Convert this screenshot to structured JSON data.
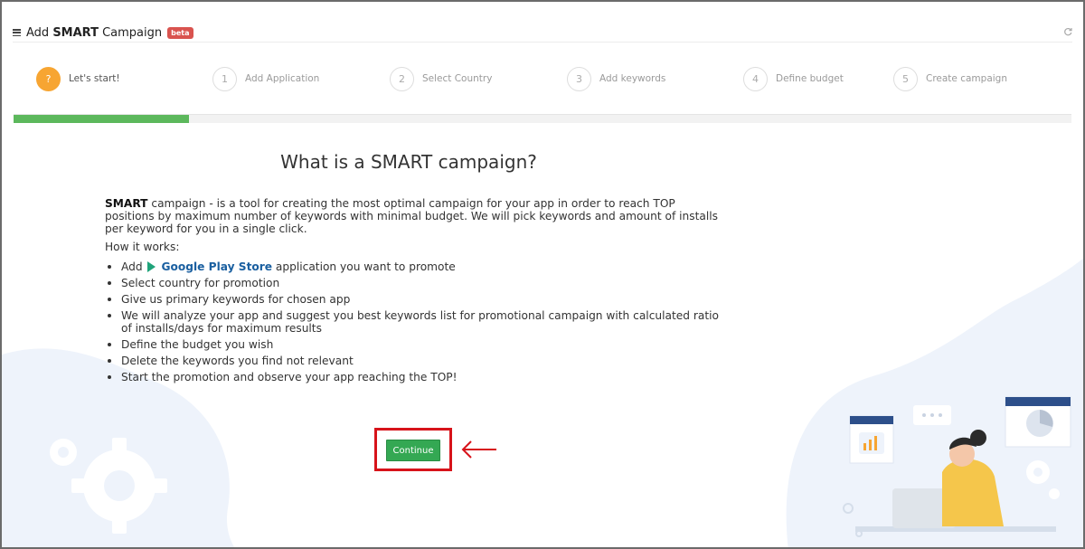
{
  "header": {
    "title_prefix": "Add ",
    "title_bold": "SMART",
    "title_suffix": " Campaign",
    "badge": "beta",
    "refresh_icon": "refresh-icon",
    "menu_icon": "hamburger-icon"
  },
  "wizard": {
    "steps": [
      {
        "num": "?",
        "label": "Let's start!",
        "active": true
      },
      {
        "num": "1",
        "label": "Add Application",
        "active": false
      },
      {
        "num": "2",
        "label": "Select Country",
        "active": false
      },
      {
        "num": "3",
        "label": "Add keywords",
        "active": false
      },
      {
        "num": "4",
        "label": "Define budget",
        "active": false
      },
      {
        "num": "5",
        "label": "Create campaign",
        "active": false
      }
    ],
    "progress_fraction": 0.166
  },
  "main": {
    "heading": "What is a SMART campaign?",
    "intro_bold": "SMART",
    "intro_rest": " campaign - is a tool for creating the most optimal campaign for your app in order to reach TOP positions by maximum number of keywords with minimal budget. We will pick keywords and amount of installs per keyword for you in a single click.",
    "how_it_works": "How it works:",
    "bullet_add_prefix": "Add ",
    "bullet_add_link": "Google Play Store",
    "bullet_add_suffix": " application you want to promote",
    "bullets": [
      "Select country for promotion",
      "Give us primary keywords for chosen app",
      "We will analyze your app and suggest you best keywords list for promotional campaign with calculated ratio of installs/days for maximum results",
      "Define the budget you wish",
      "Delete the keywords you find not relevant",
      "Start the promotion and observe your app reaching the TOP!"
    ],
    "continue_label": "Continue"
  },
  "colors": {
    "accent_orange": "#f7a532",
    "progress_green": "#5cb85c",
    "button_green": "#34a853",
    "highlight_red": "#d7131a",
    "badge_red": "#d9534f",
    "link_blue": "#1a5fa0"
  }
}
